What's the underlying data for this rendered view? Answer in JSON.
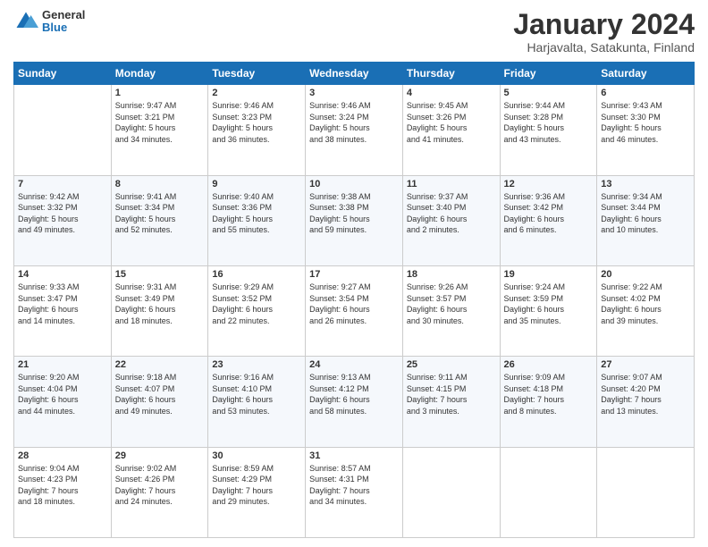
{
  "logo": {
    "general": "General",
    "blue": "Blue"
  },
  "title": "January 2024",
  "subtitle": "Harjavalta, Satakunta, Finland",
  "days_header": [
    "Sunday",
    "Monday",
    "Tuesday",
    "Wednesday",
    "Thursday",
    "Friday",
    "Saturday"
  ],
  "weeks": [
    [
      {
        "day": "",
        "info": ""
      },
      {
        "day": "1",
        "info": "Sunrise: 9:47 AM\nSunset: 3:21 PM\nDaylight: 5 hours\nand 34 minutes."
      },
      {
        "day": "2",
        "info": "Sunrise: 9:46 AM\nSunset: 3:23 PM\nDaylight: 5 hours\nand 36 minutes."
      },
      {
        "day": "3",
        "info": "Sunrise: 9:46 AM\nSunset: 3:24 PM\nDaylight: 5 hours\nand 38 minutes."
      },
      {
        "day": "4",
        "info": "Sunrise: 9:45 AM\nSunset: 3:26 PM\nDaylight: 5 hours\nand 41 minutes."
      },
      {
        "day": "5",
        "info": "Sunrise: 9:44 AM\nSunset: 3:28 PM\nDaylight: 5 hours\nand 43 minutes."
      },
      {
        "day": "6",
        "info": "Sunrise: 9:43 AM\nSunset: 3:30 PM\nDaylight: 5 hours\nand 46 minutes."
      }
    ],
    [
      {
        "day": "7",
        "info": "Sunrise: 9:42 AM\nSunset: 3:32 PM\nDaylight: 5 hours\nand 49 minutes."
      },
      {
        "day": "8",
        "info": "Sunrise: 9:41 AM\nSunset: 3:34 PM\nDaylight: 5 hours\nand 52 minutes."
      },
      {
        "day": "9",
        "info": "Sunrise: 9:40 AM\nSunset: 3:36 PM\nDaylight: 5 hours\nand 55 minutes."
      },
      {
        "day": "10",
        "info": "Sunrise: 9:38 AM\nSunset: 3:38 PM\nDaylight: 5 hours\nand 59 minutes."
      },
      {
        "day": "11",
        "info": "Sunrise: 9:37 AM\nSunset: 3:40 PM\nDaylight: 6 hours\nand 2 minutes."
      },
      {
        "day": "12",
        "info": "Sunrise: 9:36 AM\nSunset: 3:42 PM\nDaylight: 6 hours\nand 6 minutes."
      },
      {
        "day": "13",
        "info": "Sunrise: 9:34 AM\nSunset: 3:44 PM\nDaylight: 6 hours\nand 10 minutes."
      }
    ],
    [
      {
        "day": "14",
        "info": "Sunrise: 9:33 AM\nSunset: 3:47 PM\nDaylight: 6 hours\nand 14 minutes."
      },
      {
        "day": "15",
        "info": "Sunrise: 9:31 AM\nSunset: 3:49 PM\nDaylight: 6 hours\nand 18 minutes."
      },
      {
        "day": "16",
        "info": "Sunrise: 9:29 AM\nSunset: 3:52 PM\nDaylight: 6 hours\nand 22 minutes."
      },
      {
        "day": "17",
        "info": "Sunrise: 9:27 AM\nSunset: 3:54 PM\nDaylight: 6 hours\nand 26 minutes."
      },
      {
        "day": "18",
        "info": "Sunrise: 9:26 AM\nSunset: 3:57 PM\nDaylight: 6 hours\nand 30 minutes."
      },
      {
        "day": "19",
        "info": "Sunrise: 9:24 AM\nSunset: 3:59 PM\nDaylight: 6 hours\nand 35 minutes."
      },
      {
        "day": "20",
        "info": "Sunrise: 9:22 AM\nSunset: 4:02 PM\nDaylight: 6 hours\nand 39 minutes."
      }
    ],
    [
      {
        "day": "21",
        "info": "Sunrise: 9:20 AM\nSunset: 4:04 PM\nDaylight: 6 hours\nand 44 minutes."
      },
      {
        "day": "22",
        "info": "Sunrise: 9:18 AM\nSunset: 4:07 PM\nDaylight: 6 hours\nand 49 minutes."
      },
      {
        "day": "23",
        "info": "Sunrise: 9:16 AM\nSunset: 4:10 PM\nDaylight: 6 hours\nand 53 minutes."
      },
      {
        "day": "24",
        "info": "Sunrise: 9:13 AM\nSunset: 4:12 PM\nDaylight: 6 hours\nand 58 minutes."
      },
      {
        "day": "25",
        "info": "Sunrise: 9:11 AM\nSunset: 4:15 PM\nDaylight: 7 hours\nand 3 minutes."
      },
      {
        "day": "26",
        "info": "Sunrise: 9:09 AM\nSunset: 4:18 PM\nDaylight: 7 hours\nand 8 minutes."
      },
      {
        "day": "27",
        "info": "Sunrise: 9:07 AM\nSunset: 4:20 PM\nDaylight: 7 hours\nand 13 minutes."
      }
    ],
    [
      {
        "day": "28",
        "info": "Sunrise: 9:04 AM\nSunset: 4:23 PM\nDaylight: 7 hours\nand 18 minutes."
      },
      {
        "day": "29",
        "info": "Sunrise: 9:02 AM\nSunset: 4:26 PM\nDaylight: 7 hours\nand 24 minutes."
      },
      {
        "day": "30",
        "info": "Sunrise: 8:59 AM\nSunset: 4:29 PM\nDaylight: 7 hours\nand 29 minutes."
      },
      {
        "day": "31",
        "info": "Sunrise: 8:57 AM\nSunset: 4:31 PM\nDaylight: 7 hours\nand 34 minutes."
      },
      {
        "day": "",
        "info": ""
      },
      {
        "day": "",
        "info": ""
      },
      {
        "day": "",
        "info": ""
      }
    ]
  ]
}
